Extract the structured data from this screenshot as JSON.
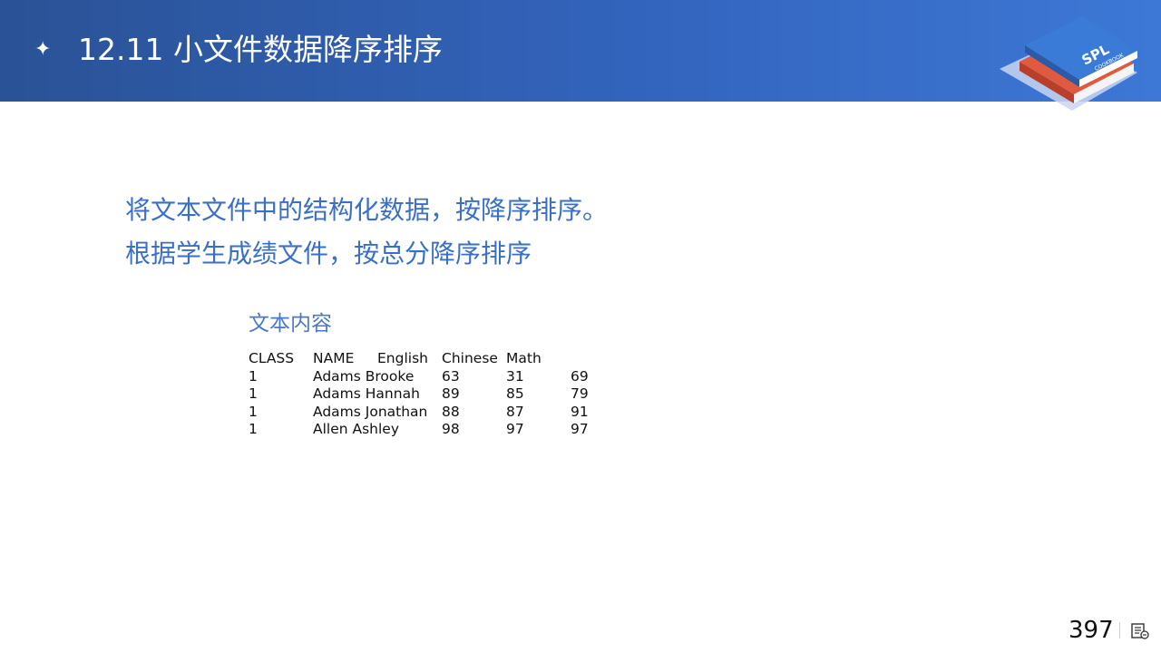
{
  "header": {
    "star": "✦",
    "title": "12.11 小文件数据降序排序"
  },
  "logo": {
    "text": "SPL",
    "subtext": "COOKBOOK"
  },
  "content": {
    "lines": [
      "将文本文件中的结构化数据，按降序排序。",
      "根据学生成绩文件，按总分降序排序"
    ],
    "subtitle": "文本内容"
  },
  "table": {
    "header": [
      "CLASS",
      "NAME",
      "English",
      "Chinese",
      "Math",
      ""
    ],
    "rows": [
      [
        "1",
        "Adams Brooke",
        "63",
        "31",
        "69"
      ],
      [
        "1",
        "Adams Hannah",
        "89",
        "85",
        "79"
      ],
      [
        "1",
        "Adams Jonathan",
        "88",
        "87",
        "91"
      ],
      [
        "1",
        "Allen Ashley",
        "98",
        "97",
        "97"
      ]
    ]
  },
  "footer": {
    "page_number": "397",
    "icon": "notes-icon"
  },
  "colors": {
    "header_start": "#2a5296",
    "header_end": "#3d78d6",
    "accent_text": "#3a6fc8"
  }
}
